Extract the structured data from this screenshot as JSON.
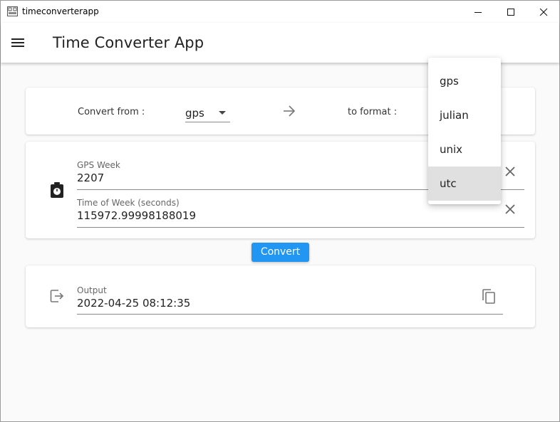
{
  "window": {
    "title": "timeconverterapp",
    "controls": {
      "minimize": "minimize-icon",
      "maximize": "maximize-icon",
      "close": "close-icon"
    }
  },
  "appbar": {
    "title": "Time Converter App",
    "menu_icon": "hamburger-menu-icon"
  },
  "format_card": {
    "from_label": "Convert from :",
    "from_value": "gps",
    "to_label": "to format :",
    "arrow_icon": "arrow-right-icon"
  },
  "input_card": {
    "icon": "stopwatch-icon",
    "fields": [
      {
        "label": "GPS Week",
        "value": "2207"
      },
      {
        "label": "Time of Week (seconds)",
        "value": "115972.99998188019"
      }
    ]
  },
  "convert_button": "Convert",
  "output_card": {
    "icon": "exit-arrow-icon",
    "label": "Output",
    "value": "2022-04-25 08:12:35",
    "copy_icon": "copy-icon"
  },
  "dropdown": {
    "options": [
      "gps",
      "julian",
      "unix",
      "utc"
    ],
    "highlighted": "utc"
  },
  "colors": {
    "accent": "#2196f3",
    "background": "#fafafa",
    "menu_highlight": "#e0e0e0"
  }
}
